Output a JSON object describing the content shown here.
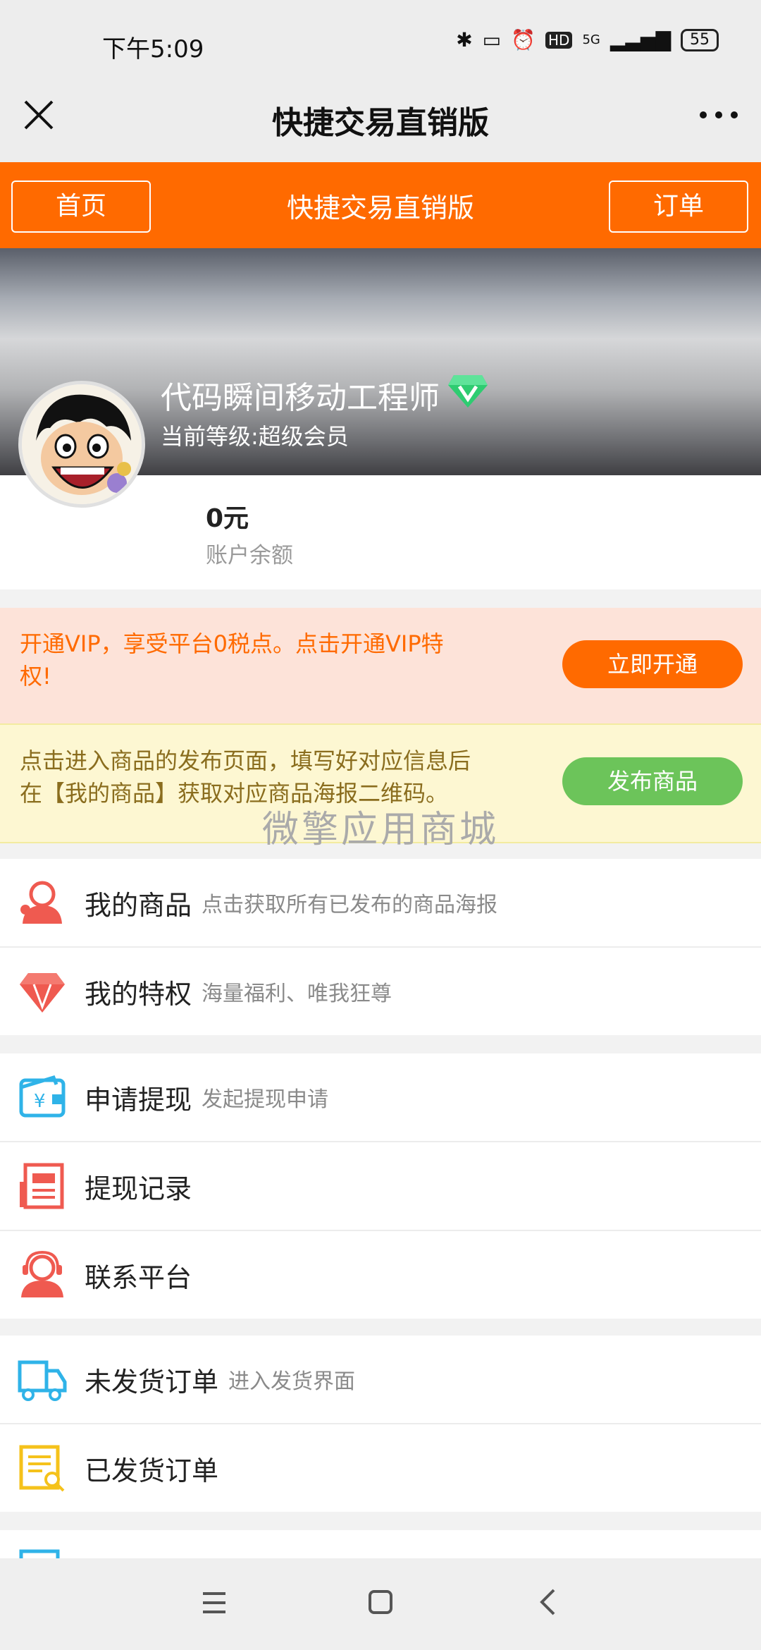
{
  "status": {
    "time": "下午5:09",
    "network": "5G",
    "hd": "HD",
    "battery": "55"
  },
  "titlebar": {
    "title": "快捷交易直销版"
  },
  "orange_bar": {
    "home": "首页",
    "title": "快捷交易直销版",
    "orders": "订单"
  },
  "profile": {
    "name": "代码瞬间移动工程师",
    "level": "当前等级:超级会员",
    "balance_value": "0元",
    "balance_label": "账户余额"
  },
  "vip": {
    "text": "开通VIP，享受平台0税点。点击开通VIP特权!",
    "button": "立即开通"
  },
  "publish": {
    "text": "点击进入商品的发布页面，填写好对应信息后在【我的商品】获取对应商品海报二维码。",
    "button": "发布商品"
  },
  "watermark": "微擎应用商城",
  "menu": {
    "my_goods": {
      "label": "我的商品",
      "sub": "点击获取所有已发布的商品海报"
    },
    "privilege": {
      "label": "我的特权",
      "sub": "海量福利、唯我狂尊"
    },
    "withdraw": {
      "label": "申请提现",
      "sub": "发起提现申请"
    },
    "withdraw_log": {
      "label": "提现记录"
    },
    "contact": {
      "label": "联系平台"
    },
    "unshipped": {
      "label": "未发货订单",
      "sub": "进入发货界面"
    },
    "shipped": {
      "label": "已发货订单"
    }
  },
  "colors": {
    "brand_orange": "#ff6a00",
    "green": "#6cc45a",
    "icon_red": "#ef5a50",
    "icon_blue": "#2fb3e8",
    "icon_yellow": "#f5c21b"
  }
}
